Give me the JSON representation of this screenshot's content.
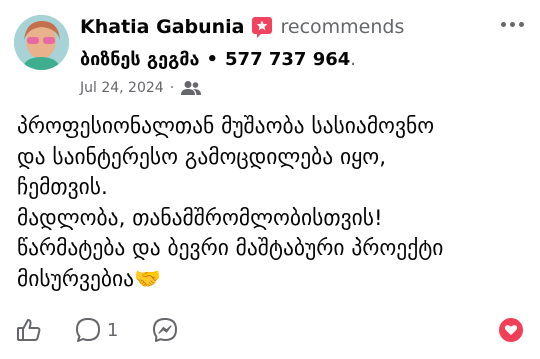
{
  "post": {
    "author": "Khatia Gabunia",
    "action": "recommends",
    "page_name": "ბიზნეს გეგმა",
    "separator": "•",
    "phone": "577 737 964",
    "period": ".",
    "date": "Jul 24, 2024",
    "date_separator": "·",
    "audience_icon": "friends-icon",
    "text_lines": [
      "პროფესიონალთან მუშაობა სასიამოვნო",
      "და საინტერესო გამოცდილება იყო,",
      "ჩემთვის.",
      "მადლობა, თანამშრომლობისთვის!",
      "წარმატება და ბევრი მაშტაბური პროექტი",
      "მისურვებია🤝"
    ]
  },
  "actions": {
    "comment_count": "1",
    "like_icon": "thumbs-up-icon",
    "comment_icon": "comment-bubble-icon",
    "share_icon": "messenger-icon",
    "reaction_icon": "heart-icon"
  },
  "colors": {
    "recommend_badge": "#f3425f",
    "secondary_text": "#65676b",
    "heart": "#f33e58"
  }
}
